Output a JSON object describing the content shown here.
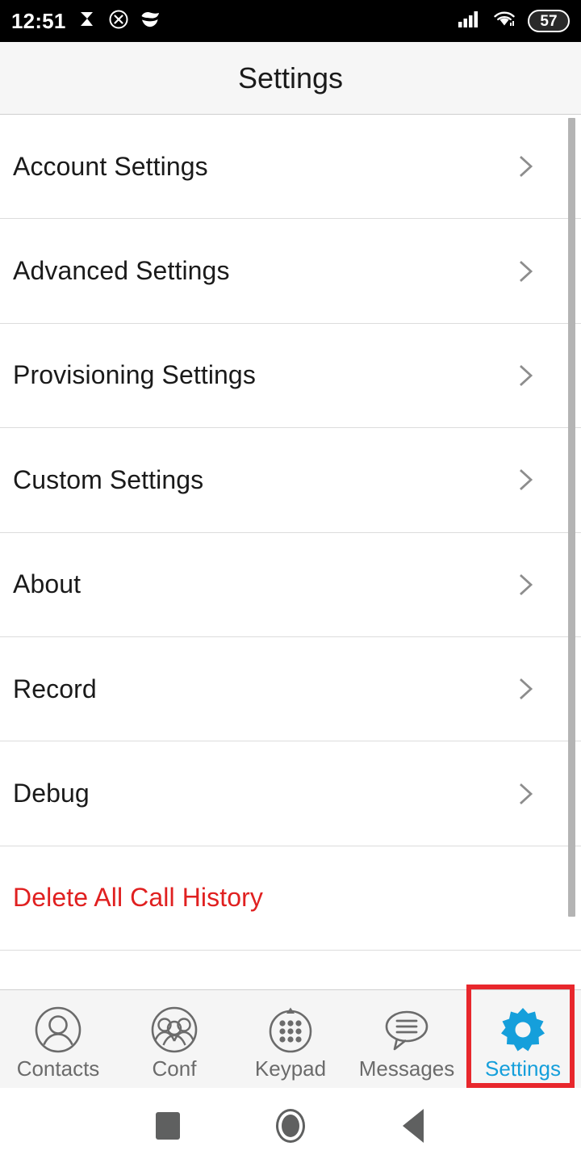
{
  "status_bar": {
    "time": "12:51",
    "left_icons": [
      "pennant-icon",
      "cancel-circle-icon",
      "smiley-icon"
    ],
    "right_icons": [
      "cellular-signal-icon",
      "wifi-icon"
    ],
    "battery_level": "57",
    "background_color": "#000000",
    "foreground_color": "#ffffff"
  },
  "header": {
    "title": "Settings",
    "background_color": "#f6f6f6"
  },
  "list": {
    "items": [
      {
        "label": "Account Settings",
        "chevron": "chevron-right-icon",
        "style": "normal"
      },
      {
        "label": "Advanced Settings",
        "chevron": "chevron-right-icon",
        "style": "normal"
      },
      {
        "label": "Provisioning Settings",
        "chevron": "chevron-right-icon",
        "style": "normal"
      },
      {
        "label": "Custom Settings",
        "chevron": "chevron-right-icon",
        "style": "normal"
      },
      {
        "label": "About",
        "chevron": "chevron-right-icon",
        "style": "normal"
      },
      {
        "label": "Record",
        "chevron": "chevron-right-icon",
        "style": "normal"
      },
      {
        "label": "Debug",
        "chevron": "chevron-right-icon",
        "style": "normal"
      },
      {
        "label": "Delete All Call History",
        "chevron": null,
        "style": "danger"
      }
    ],
    "danger_color": "#e02020",
    "text_color": "#1a1a1a",
    "divider_color": "#dcdcdc"
  },
  "scrollbar": {
    "name": "vertical-scrollbar",
    "color": "#b4b4b4"
  },
  "tab_bar": {
    "background_color": "#f5f5f5",
    "inactive_color": "#6b6b6b",
    "active_color": "#159fdb",
    "tabs": [
      {
        "label": "Contacts",
        "icon": "contact-person-circle-icon",
        "active": false
      },
      {
        "label": "Conf",
        "icon": "conference-group-circle-icon",
        "active": false
      },
      {
        "label": "Keypad",
        "icon": "keypad-dots-circle-icon",
        "active": false
      },
      {
        "label": "Messages",
        "icon": "message-bubble-icon",
        "active": false
      },
      {
        "label": "Settings",
        "icon": "gear-icon",
        "active": true
      }
    ]
  },
  "highlight": {
    "name": "settings-tab-highlight",
    "color": "#e8272c"
  },
  "nav_bar": {
    "buttons": [
      {
        "name": "recents-button",
        "icon": "square-icon"
      },
      {
        "name": "home-button",
        "icon": "circle-icon"
      },
      {
        "name": "back-button",
        "icon": "triangle-left-icon"
      }
    ],
    "color": "#5f6060"
  }
}
